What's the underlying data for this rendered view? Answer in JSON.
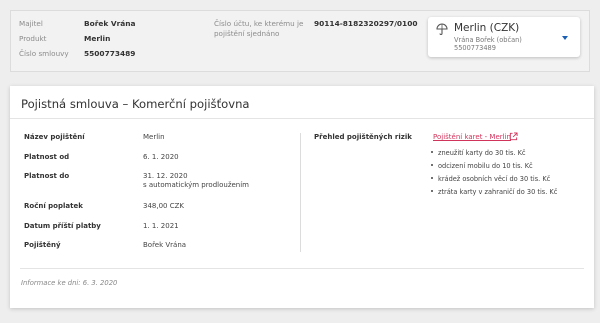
{
  "header": {
    "fields": [
      {
        "label": "Majitel",
        "value": "Bořek Vrána"
      },
      {
        "label": "Produkt",
        "value": "Merlin"
      },
      {
        "label": "Číslo smlouvy",
        "value": "5500773489"
      }
    ],
    "payment_account_label": "Číslo účtu, ke kterému je pojištění sjednáno",
    "payment_account_value": "90114-8182320297/0100"
  },
  "account_selector": {
    "name": "Merlin (CZK)",
    "owner": "Vrána Bořek (občan)",
    "number": "5500773489"
  },
  "panel": {
    "title": "Pojistná smlouva – Komerční pojišťovna",
    "rows": [
      {
        "label": "Název pojištění",
        "value": "Merlin"
      },
      {
        "label": "Platnost od",
        "value": "6. 1. 2020"
      },
      {
        "label": "Platnost do",
        "value": "31. 12. 2020",
        "value2": "s automatickým prodloužením"
      },
      {
        "label": "Roční poplatek",
        "value": "348,00 CZK"
      },
      {
        "label": "Datum příští platby",
        "value": "1. 1. 2021"
      },
      {
        "label": "Pojištěný",
        "value": "Bořek Vrána"
      }
    ],
    "risks": {
      "label": "Přehled pojištěných rizik",
      "link": "Pojištění karet - Merlin",
      "items": [
        "zneužití karty do 30 tis. Kč",
        "odcizení mobilu do 10 tis. Kč",
        "krádež osobních věcí do 30 tis. Kč",
        "ztráta karty v zahraničí do 30 tis. Kč"
      ]
    },
    "footnote": "Informace ke dni: 6. 3. 2020"
  },
  "colors": {
    "accent_link": "#d1345b",
    "caret": "#1a5fb4",
    "background": "#eeeeee"
  }
}
